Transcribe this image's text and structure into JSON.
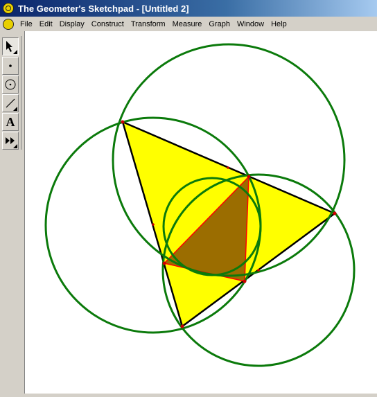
{
  "window": {
    "title": "The Geometer's Sketchpad - [Untitled 2]"
  },
  "menu": {
    "items": [
      "File",
      "Edit",
      "Display",
      "Construct",
      "Transform",
      "Measure",
      "Graph",
      "Window",
      "Help"
    ]
  },
  "toolbox": {
    "tools": [
      {
        "name": "selection-arrow",
        "icon": "arrow-icon",
        "active": true
      },
      {
        "name": "point",
        "icon": "point-icon",
        "active": false
      },
      {
        "name": "compass",
        "icon": "compass-icon",
        "active": false
      },
      {
        "name": "straightedge",
        "icon": "straightedge-icon",
        "active": false
      },
      {
        "name": "text",
        "icon": "text-icon",
        "label": "A",
        "active": false
      },
      {
        "name": "custom",
        "icon": "custom-tool-icon",
        "active": false
      }
    ]
  },
  "colors": {
    "triangle_fill": "#ffff00",
    "inner_triangle_fill": "#9b6d00",
    "circle_stroke": "#0b7a0b",
    "edge_stroke": "#000000",
    "inner_edge_stroke": "#ff0000",
    "point_color": "#cc0000"
  }
}
